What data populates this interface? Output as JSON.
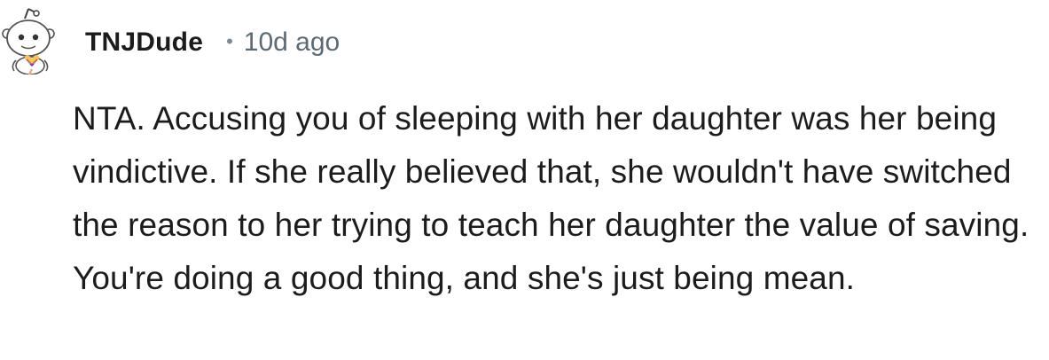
{
  "comment": {
    "author": "TNJDude",
    "separator": "•",
    "timestamp": "10d ago",
    "body": "NTA. Accusing you of sleeping with her daughter was her being vindictive. If she really believed that, she wouldn't have switched the reason to her trying to teach her daughter the value of saving. You're doing a good thing, and she's just being mean."
  },
  "colors": {
    "text": "#1c1c1c",
    "meta": "#5b6b76",
    "background": "#ffffff"
  },
  "icons": {
    "avatar": "snoo-avatar-icon"
  }
}
